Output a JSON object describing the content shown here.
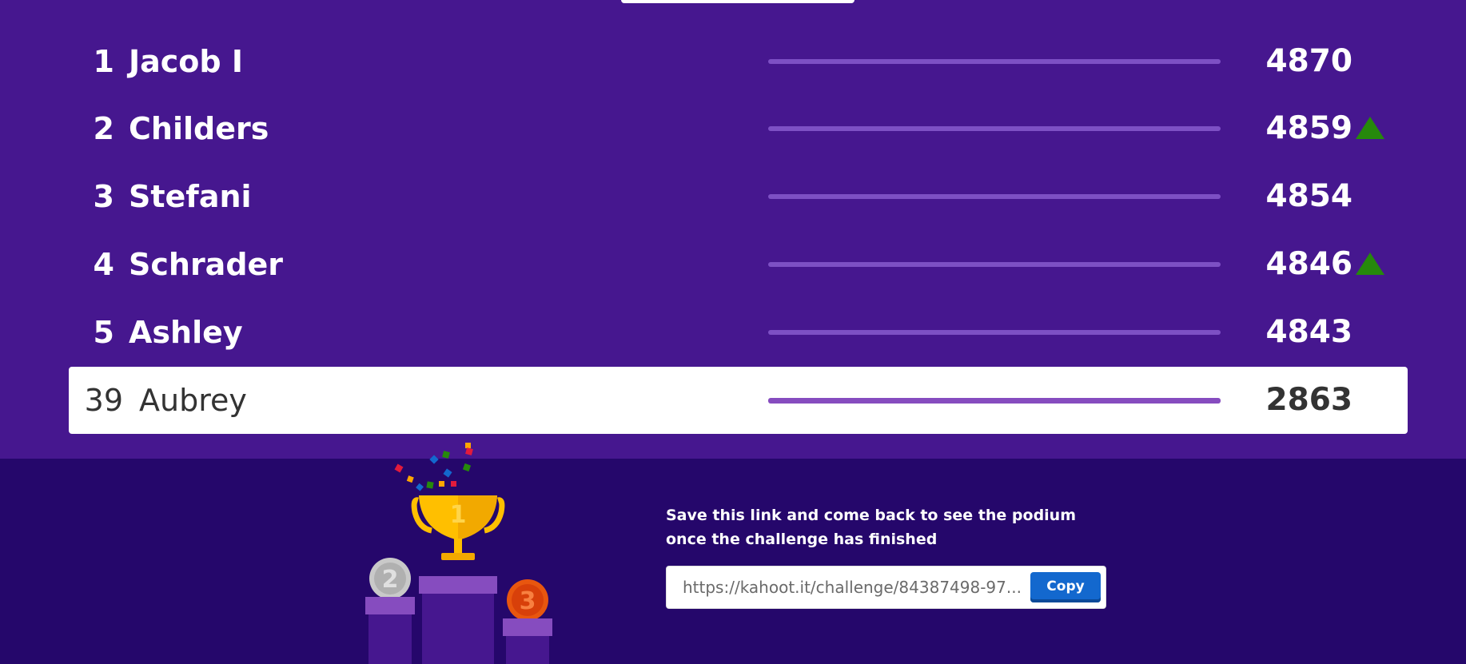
{
  "leaderboard": {
    "rows": [
      {
        "rank": "1",
        "name": "Jacob I",
        "score": "4870",
        "trend": "none"
      },
      {
        "rank": "2",
        "name": "Childers",
        "score": "4859",
        "trend": "up"
      },
      {
        "rank": "3",
        "name": "Stefani",
        "score": "4854",
        "trend": "none"
      },
      {
        "rank": "4",
        "name": "Schrader",
        "score": "4846",
        "trend": "up"
      },
      {
        "rank": "5",
        "name": "Ashley",
        "score": "4843",
        "trend": "none"
      }
    ],
    "current_player": {
      "rank": "39",
      "name": "Aubrey",
      "score": "2863"
    }
  },
  "footer": {
    "message_line1": "Save this link and come back to see the podium",
    "message_line2": "once the challenge has finished",
    "link_value": "https://kahoot.it/challenge/84387498-97...",
    "copy_label": "Copy"
  },
  "podium": {
    "first_label": "1",
    "second_label": "2",
    "third_label": "3"
  },
  "colors": {
    "background": "#46178f",
    "footer_background": "#25076b",
    "bar": "#7d50c4",
    "up_arrow": "#26890c",
    "copy_button": "#1368ce"
  }
}
